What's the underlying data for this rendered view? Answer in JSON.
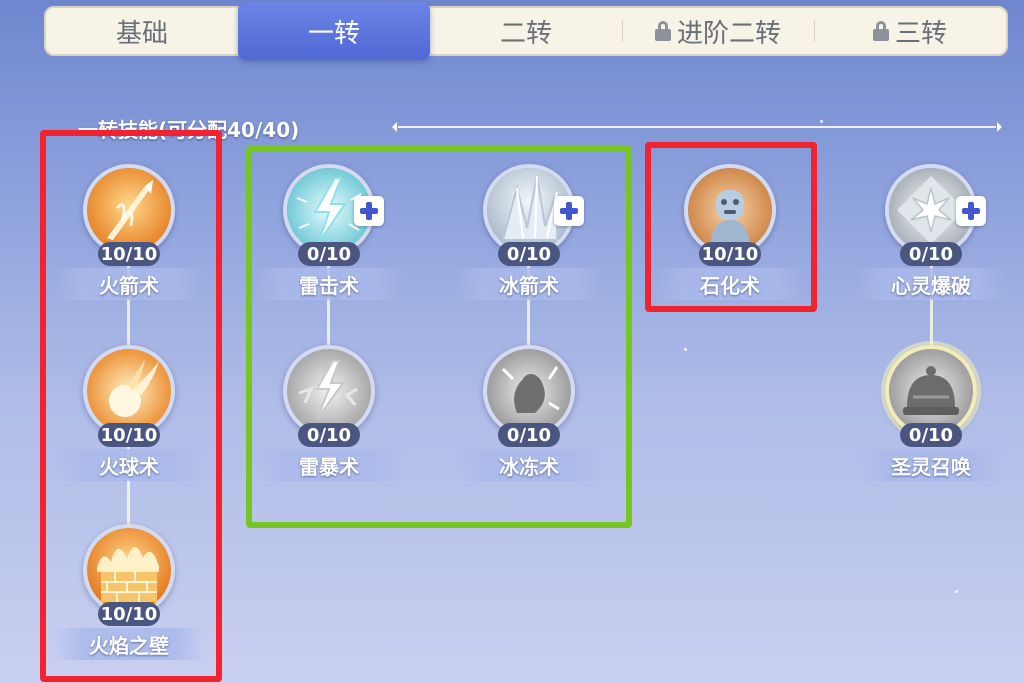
{
  "tabs": [
    {
      "label": "基础",
      "active": false,
      "locked": false
    },
    {
      "label": "一转",
      "active": true,
      "locked": false
    },
    {
      "label": "二转",
      "active": false,
      "locked": false
    },
    {
      "label": "进阶二转",
      "active": false,
      "locked": true
    },
    {
      "label": "三转",
      "active": false,
      "locked": true
    }
  ],
  "section": {
    "title": "一转技能(可分配40/40)"
  },
  "skills": {
    "fire_arrow": {
      "name": "火箭术",
      "level": "10/10",
      "icon": "fire-arrow-icon"
    },
    "fireball": {
      "name": "火球术",
      "level": "10/10",
      "icon": "fireball-icon"
    },
    "fire_wall": {
      "name": "火焰之壁",
      "level": "10/10",
      "icon": "fire-wall-icon"
    },
    "thunder": {
      "name": "雷击术",
      "level": "0/10",
      "icon": "lightning-icon"
    },
    "thunderstorm": {
      "name": "雷暴术",
      "level": "0/10",
      "icon": "thunderstorm-icon"
    },
    "ice_arrow": {
      "name": "冰箭术",
      "level": "0/10",
      "icon": "ice-crystal-icon"
    },
    "freeze": {
      "name": "冰冻术",
      "level": "0/10",
      "icon": "freeze-icon"
    },
    "petrify": {
      "name": "石化术",
      "level": "10/10",
      "icon": "petrify-statue-icon"
    },
    "mind_blast": {
      "name": "心灵爆破",
      "level": "0/10",
      "icon": "mind-blast-icon"
    },
    "holy_summon": {
      "name": "圣灵召唤",
      "level": "0/10",
      "icon": "holy-bell-icon"
    }
  },
  "colors": {
    "active_tab": "#5a74dc",
    "annotation_red": "#f2222e",
    "annotation_green": "#77c521",
    "plus_blue": "#4257cf"
  }
}
